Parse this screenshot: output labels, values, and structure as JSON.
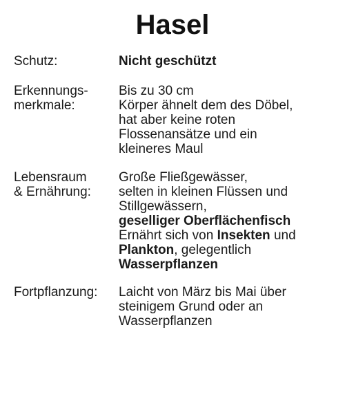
{
  "title": "Hasel",
  "schutz": {
    "label": "Schutz:",
    "value": "Nicht geschützt"
  },
  "erkennungsmerkmale": {
    "label_lines": [
      "Erkennungs-",
      "merkmale:"
    ],
    "value_lines": [
      "Bis zu 30 cm",
      "Körper ähnelt dem des Döbel,",
      "hat aber keine roten",
      "Flossenansätze und ein",
      "kleineres Maul"
    ]
  },
  "lebensraum": {
    "label_lines": [
      "Lebensraum",
      "& Ernährung:"
    ],
    "line1": "Große Fließgewässer,",
    "line2": "selten in kleinen Flüssen und",
    "line3": "Stillgewässern,",
    "line4_bold": "geselliger Oberflächenfisch",
    "line5_pre": "Ernährt sich von ",
    "line5_bold": "Insekten",
    "line5_post": " und",
    "line6_bold": "Plankton",
    "line6_post": ", gelegentlich",
    "line7_bold": "Wasserpflanzen"
  },
  "fortpflanzung": {
    "label": "Fortpflanzung:",
    "value_lines": [
      "Laicht von März bis Mai über",
      "steinigem Grund oder an",
      "Wasserpflanzen"
    ]
  }
}
